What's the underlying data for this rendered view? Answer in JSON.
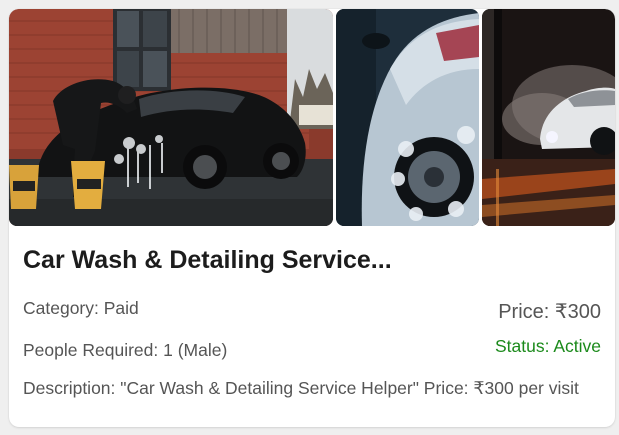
{
  "card": {
    "title": "Car Wash & Detailing Service...",
    "category": "Category: Paid",
    "price": "Price: ₹300",
    "people_required": "People Required: 1 (Male)",
    "status": "Status: Active",
    "description": "Description: \"Car Wash & Detailing Service Helper\" Price: ₹300 per visit",
    "colors": {
      "status_active": "#1b8a1b",
      "text_secondary": "#555555",
      "title": "#1c1c1c"
    }
  }
}
